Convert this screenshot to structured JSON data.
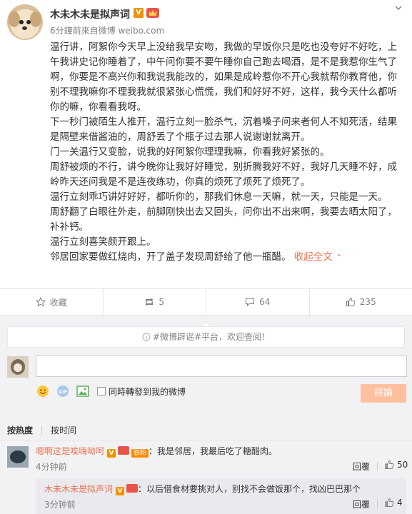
{
  "post": {
    "username": "木未木未是拟声词",
    "verified_badge": "V",
    "meta": "6分鐘前來自微博 weibo.com",
    "paragraphs": [
      "温行讲，阿絮你今天早上没给我早安吻，我做的早饭你只是吃也没夸好不好吃，上午我讲史记你睡着了，中午问你要不要午睡你自己跑去喝酒，是不是我惹你生气了啊，你要是不高兴你和我说我能改的，如果是成岭惹你不开心我就帮你教育他，你别不理我嘛你不理我我就很紧张心慌慌，我们和好好不好，这样，我今天什么都听你的嘛，你看看我呀。",
      "下一秒门被陌生人推开，温行立刻一脸杀气，沉着嗓子问来者何人不知死活，结果是隔壁来借酱油的，周舒丢了个瓶子过去那人说谢谢就离开。",
      "门一关温行又变脸，说我的好阿絮你理理我嘛，你看我好紧张的。",
      "周舒被烦的不行，讲今晚你让我好好睡觉，别折腾我好不好，我好几天睡不好，成岭昨天还问我是不是连夜练功，你真的烦死了烦死了烦死了。",
      "温行立刻乖巧讲好好好，都听你的，那我们休息一天嘛，就一天，只能是一天。",
      "周舒翻了白眼往外走，前脚刚快出去又回头，问你出不出来啊，我要去晒太阳了，补补钙。",
      "温行立刻喜笑颜开跟上。"
    ],
    "last_line": "邻居回家要做红烧肉，开了盖子发现周舒给了他一瓶醋。",
    "expand_label": "收起全文"
  },
  "actions": {
    "collect": "收藏",
    "repost": "5",
    "comment": "64",
    "like": "235"
  },
  "comments": {
    "notice_prefix": "#微博辟谣#平台，",
    "notice_link": "欢迎查阅！",
    "sync_label": "同時轉發到我的微博",
    "submit_label": "評論",
    "sort_hot": "按热度",
    "sort_time": "按时间",
    "items": [
      {
        "user": "嗯啊这是唉嗨呦呵",
        "fan_badge": "铁粉",
        "text": "：我是邻居，我最后吃了糖醋肉。",
        "time": "4分钟前",
        "reply": "回覆",
        "likes": "50"
      },
      {
        "user": "木未木未是拟声词",
        "text": "：以后借食材要挑对人，别找不会做饭那个，找凶巴巴那个",
        "time": "3分钟前",
        "reply": "回覆",
        "likes": "4"
      }
    ]
  },
  "colors": {
    "accent": "#eb7350",
    "verified": "#f29100",
    "muted": "#808080"
  }
}
